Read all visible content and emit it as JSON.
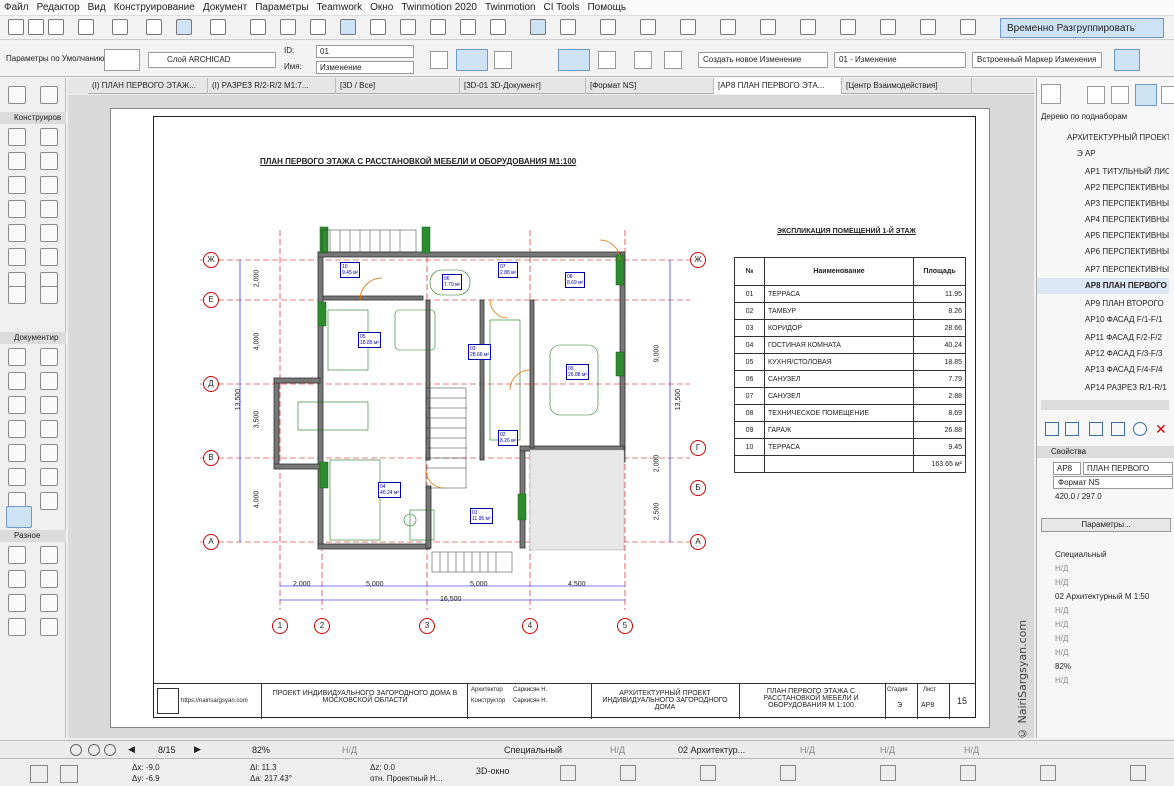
{
  "menu": [
    "Файл",
    "Редактор",
    "Вид",
    "Конструирование",
    "Документ",
    "Параметры",
    "Teamwork",
    "Окно",
    "Twinmotion 2020",
    "Twinmotion",
    "CI Tools",
    "Помощь"
  ],
  "toolbar": {
    "group_button": "Временно Разгруппировать"
  },
  "infobox": {
    "defaults_label": "Параметры по Умолчанию",
    "layer": "Слой ARCHICAD",
    "id_label": "ID:",
    "id_value": "01",
    "name_label": "Имя:",
    "name_value": "Изменение",
    "change_combo": "Создать новое Изменение",
    "change_id": "01 - Изменение",
    "marker": "Встроенный Маркер Изменения"
  },
  "tabs": [
    {
      "label": "(I) ПЛАН ПЕРВОГО ЭТАЖ..."
    },
    {
      "label": "(I) РАЗРЕЗ R/2-R/2 M1:7..."
    },
    {
      "label": "[3D / Все]"
    },
    {
      "label": "[3D-01 3D-Документ]"
    },
    {
      "label": "[Формат NS]"
    },
    {
      "label": "[АР8 ПЛАН ПЕРВОГО ЭТА..."
    },
    {
      "label": "[Центр Взаимодействия]"
    }
  ],
  "toolbox": {
    "sections": [
      "Конструиров",
      "Документир",
      "Разное"
    ]
  },
  "drawing": {
    "title": "ПЛАН ПЕРВОГО ЭТАЖА С РАССТАНОВКОЙ МЕБЕЛИ И ОБОРУДОВАНИЯ М1:100",
    "table_title": "ЭКСПЛИКАЦИЯ ПОМЕЩЕНИЙ 1-Й ЭТАЖ",
    "table_headers": [
      "№",
      "Наименование",
      "Площадь"
    ],
    "rooms": [
      [
        "01",
        "ТЕРРАСА",
        "11.95"
      ],
      [
        "02",
        "ТАМБУР",
        "8.26"
      ],
      [
        "03",
        "КОРИДОР",
        "28.66"
      ],
      [
        "04",
        "ГОСТИНАЯ КОМНАТА",
        "40.24"
      ],
      [
        "05",
        "КУХНЯ/СТОЛОВАЯ",
        "18.85"
      ],
      [
        "06",
        "САНУЗЕЛ",
        "7.79"
      ],
      [
        "07",
        "САНУЗЕЛ",
        "2.88"
      ],
      [
        "08",
        "ТЕХНИЧЕСКОЕ ПОМЕЩЕНИЕ",
        "8.69"
      ],
      [
        "09",
        "ГАРАЖ",
        "26.88"
      ],
      [
        "10",
        "ТЕРРАСА",
        "9.45"
      ]
    ],
    "total": "163.65 м²",
    "axes_letters": [
      "Ж",
      "Е",
      "Д",
      "В",
      "А",
      "Г",
      "Б"
    ],
    "axes_numbers": [
      "1",
      "2",
      "3",
      "4",
      "5"
    ],
    "dims_bottom": [
      "2,000",
      "5,000",
      "5,000",
      "4,500"
    ],
    "dim_total": "16,500",
    "dims_left": [
      "2,000",
      "4,000",
      "3,500",
      "4,000"
    ],
    "dim_left_total": "13,500",
    "dims_right": [
      "9,000",
      "2,000",
      "2,500"
    ],
    "dim_right_total": "13,500",
    "room_tags": [
      {
        "id": "10",
        "area": "9.45 м²"
      },
      {
        "id": "06",
        "area": "7.79 м²"
      },
      {
        "id": "07",
        "area": "2.88 м²"
      },
      {
        "id": "08",
        "area": "8.69 м²"
      },
      {
        "id": "05",
        "area": "18.85 м²"
      },
      {
        "id": "03",
        "area": "28.66 м²"
      },
      {
        "id": "09",
        "area": "26.88 м²"
      },
      {
        "id": "02",
        "area": "8.26 м²"
      },
      {
        "id": "04",
        "area": "40.24 м²"
      },
      {
        "id": "01",
        "area": "11.95 м²"
      }
    ]
  },
  "title_block": {
    "website": "https://nairisargsyan.com",
    "project": "ПРОЕКТ ИНДИВИДУАЛЬНОГО ЗАГОРОДНОГО ДОМА В МОСКОВСКОЙ ОБЛАСТИ",
    "role1": "Архитектор",
    "name1": "Саркисян Н.",
    "role2": "Конструктор",
    "name2": "Саркисян Н.",
    "type": "АРХИТЕКТУРНЫЙ ПРОЕКТ ИНДИВИДУАЛЬНОГО ЗАГОРОДНОГО ДОМА",
    "sheet_name": "ПЛАН ПЕРВОГО ЭТАЖА С РАССТАНОВКОЙ МЕБЕЛИ И ОБОРУДОВАНИЯ М 1:100",
    "stage_label": "Стадия",
    "stage": "Э",
    "sheet_label": "Лист",
    "sheet": "АР8",
    "page": "15"
  },
  "navigator": {
    "header": "Дерево по поднаборам",
    "root": "АРХИТЕКТУРНЫЙ ПРОЕКТ",
    "folder": "Э АР",
    "items": [
      "АР1 ТИТУЛЬНЫЙ ЛИС",
      "АР2 ПЕРСПЕКТИВНЫ",
      "АР3 ПЕРСПЕКТИВНЫ",
      "АР4 ПЕРСПЕКТИВНЫ",
      "АР5 ПЕРСПЕКТИВНЫ",
      "АР6 ПЕРСПЕКТИВНЫ",
      "АР7 ПЕРСПЕКТИВНЫ",
      "АР8 ПЛАН ПЕРВОГО",
      "АР9 ПЛАН ВТОРОГО",
      "АР10 ФАСАД F/1-F/1",
      "АР11 ФАСАД F/2-F/2",
      "АР12 ФАСАД F/3-F/3",
      "АР13 ФАСАД F/4-F/4",
      "АР14 РАЗРЕЗ R/1-R/1"
    ],
    "properties_label": "Свойства",
    "prop_id": "АР8",
    "prop_name": "ПЛАН ПЕРВОГО ЭТАЖА",
    "format": "Формат NS",
    "size": "420.0 / 297.0",
    "params_button": "Параметры...",
    "layer_set": "Специальный",
    "nd": "Н/Д",
    "scale": "02 Архитектурный М 1:50",
    "zoom": "82%"
  },
  "status": {
    "page": "8/15",
    "zoom": "82%",
    "nd": "Н/Д",
    "layer": "Специальный",
    "scale": "02 Архитектур..."
  },
  "coords": {
    "dx": "Δx: -9.0",
    "dy": "Δy: -6.9",
    "dl": "Δl: 11.3",
    "da": "Δa: 217.43°",
    "dz": "Δz: 0.0",
    "ref": "отн. Проектный Н...",
    "view": "3D-окно"
  },
  "watermark": "© NairiSargsyan.com"
}
